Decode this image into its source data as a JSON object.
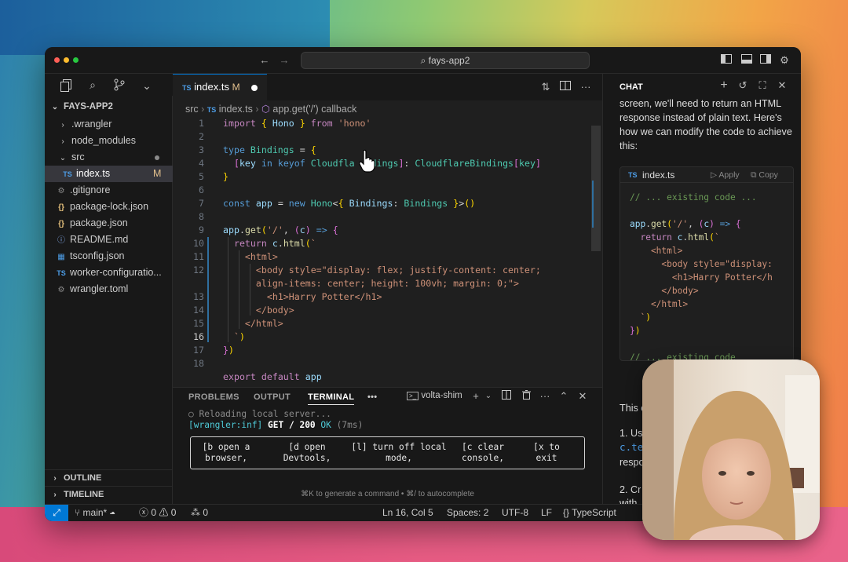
{
  "window": {
    "title": "fays-app2"
  },
  "colors": {
    "accent": "#0078d4",
    "close": "#ff5f57",
    "minimize": "#febc2e",
    "maximize": "#28c840"
  },
  "explorer": {
    "root": "FAYS-APP2",
    "items": [
      {
        "label": ".wrangler",
        "icon": "chevron-right-icon"
      },
      {
        "label": "node_modules",
        "icon": "chevron-right-icon"
      },
      {
        "label": "src",
        "icon": "chevron-down-icon"
      },
      {
        "label": "index.ts",
        "icon": "typescript-icon",
        "badge": "M"
      },
      {
        "label": ".gitignore",
        "icon": "gear-icon"
      },
      {
        "label": "package-lock.json",
        "icon": "json-icon"
      },
      {
        "label": "package.json",
        "icon": "json-icon"
      },
      {
        "label": "README.md",
        "icon": "info-icon"
      },
      {
        "label": "tsconfig.json",
        "icon": "tsconfig-icon"
      },
      {
        "label": "worker-configuratio...",
        "icon": "typescript-icon"
      },
      {
        "label": "wrangler.toml",
        "icon": "gear-icon"
      }
    ],
    "outline": "OUTLINE",
    "timeline": "TIMELINE"
  },
  "editor": {
    "tab": {
      "label": "index.ts",
      "badge": "M",
      "icon": "TS"
    },
    "breadcrumbs": {
      "folder": "src",
      "file": "index.ts",
      "symbol": "app.get('/') callback"
    },
    "line_numbers": [
      "1",
      "2",
      "3",
      "4",
      "5",
      "6",
      "7",
      "8",
      "9",
      "10",
      "11",
      "12",
      "",
      "13",
      "14",
      "15",
      "16",
      "17",
      "18"
    ],
    "current_line": "16"
  },
  "panel": {
    "tabs": [
      "PROBLEMS",
      "OUTPUT",
      "TERMINAL",
      "•••"
    ],
    "active_tab": "TERMINAL",
    "shell": "volta-shim",
    "lines": {
      "reloading": "○ Reloading local server...",
      "log_prefix": "[wrangler:inf]",
      "log_method": "GET / 200",
      "log_ok": "OK",
      "log_time": "(7ms)"
    },
    "hints": [
      {
        "key": "[b",
        "text1": "open a",
        "text2": "browser,"
      },
      {
        "key": "[d",
        "text1": "open",
        "text2": "Devtools,"
      },
      {
        "key": "[l]",
        "text1": "turn off local",
        "text2": "mode,"
      },
      {
        "key": "[c",
        "text1": "clear",
        "text2": "console,"
      },
      {
        "key": "[x",
        "text1": "to",
        "text2": "exit"
      }
    ],
    "footer_hint": "⌘K to generate a command • ⌘/ to autocomplete"
  },
  "status": {
    "branch": "main*",
    "errors": "0",
    "warnings": "0",
    "ports": "0",
    "position": "Ln 16, Col 5",
    "spaces": "Spaces: 2",
    "encoding": "UTF-8",
    "eol": "LF",
    "language": "TypeScript"
  },
  "chat": {
    "title": "CHAT",
    "intro": "screen, we'll need to return an HTML response instead of plain text. Here's how we can modify the code to achieve this:",
    "code_file": "index.ts",
    "apply": "Apply",
    "copy": "Copy",
    "after1": "This c",
    "after2": "1. Us",
    "after3": "c.te",
    "after4": "respo",
    "after5": "2. Cr",
    "after6": "with"
  }
}
